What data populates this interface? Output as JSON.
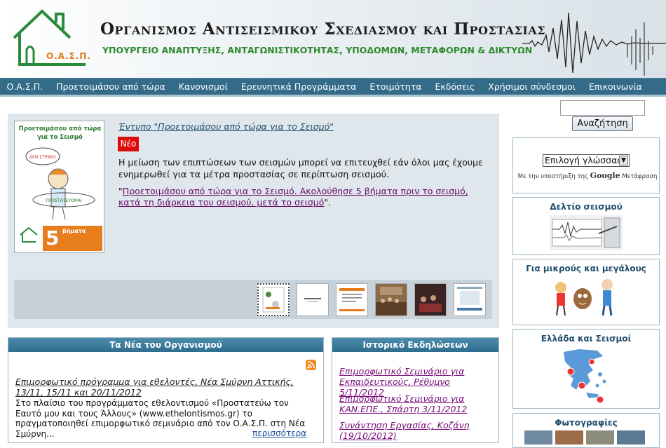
{
  "header": {
    "logo_text": "Ο.Α.Σ.Π.",
    "title": "Οργανισμος Αντισεισμικου Σχεδιασμου και Προστασιας",
    "subtitle": "ΥΠΟΥΡΓΕΙΟ ΑΝΑΠΤΥΞΗΣ, ΑΝΤΑΓΩΝΙΣΤΙΚΟΤΗΤΑΣ, ΥΠΟΔΟΜΩΝ, ΜΕΤΑΦΟΡΩΝ & ΔΙΚΤΥΩΝ"
  },
  "nav": {
    "items": [
      "Ο.Α.Σ.Π.",
      "Προετοιμάσου από τώρα",
      "Κανονισμοί",
      "Ερευνητικά Προγράμματα",
      "Ετοιμότητα",
      "Εκδόσεις",
      "Χρήσιμοι σύνδεσμοι",
      "Επικοινωνία"
    ]
  },
  "feature": {
    "thumb_line1": "Προετοιμάσου από τώρα",
    "thumb_line2": "για το Σεισμό",
    "thumb_number": "5",
    "thumb_word": "βήματα",
    "title": "Έντυπο \"Προετοιμάσου από τώρα για το Σεισμό\"",
    "badge": "Νέο",
    "text": "Η μείωση των επιπτώσεων των σεισμών μπορεί να επιτευχθεί εάν όλοι μας έχουμε ενημερωθεί για τα μέτρα προστασίας σε περίπτωση σεισμού.",
    "link_open_quote": "\"",
    "link_text": "Προετοιμάσου από τώρα για το Σεισμό. Ακολούθησε 5 βήματα πριν το σεισμό, κατά τη διάρκεια του σεισμού, μετά το σεισμό",
    "link_close_quote": "\"."
  },
  "news": {
    "header": "Τα Νέα του Οργανισμού",
    "title": "Επιμορφωτικό πρόγραμμα για εθελοντές, Νέα Σμύρνη Αττικής, 13/11, 15/11 και 20/11/2012",
    "body": "Στο πλαίσιο του προγράμματος εθελοντισμού «Προστατεύω τον Εαυτό μου και τους Άλλους» (www.ethelontismos.gr) το πραγματοποιηθεί επιμορφωτικό σεμινάριο από τον Ο.Α.Σ.Π. στη Νέα Σμύρνη...",
    "more": "περισσότερα"
  },
  "events": {
    "header": "Ιστορικό Εκδηλώσεων",
    "items": [
      "Επιμορφωτικό Σεμινάριο για Εκπαιδευτικούς, Ρέθυμνο 5/11/2012",
      "Επιμορφωτικό Σεμινάριο για ΚΑΝ.ΕΠΕ., Σπάρτη 3/11/2012",
      "Συνάντηση Εργασίας, Κοζάνη (19/10/2012)"
    ]
  },
  "sidebar": {
    "search_button": "Αναζήτηση",
    "search_value": "",
    "language_select": "Επιλογή γλώσσας",
    "powered_prefix": "Με την υποστήριξη της",
    "powered_brand": "Google",
    "powered_suffix": "Μετάφραση",
    "bulletin_title": "Δελτίο σεισμού",
    "kids_title": "Για μικρούς και μεγάλους",
    "greece_title": "Ελλάδα και Σεισμοί",
    "photos_title": "Φωτογραφίες"
  },
  "colors": {
    "nav_bg": "#336b88",
    "feature_bg": "#dfe6ec",
    "badge_red": "#dd0a0a",
    "subtitle_green": "#2d8a2d",
    "logo_orange": "#e07a14"
  }
}
